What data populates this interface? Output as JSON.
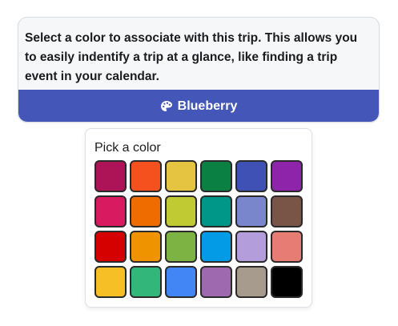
{
  "card": {
    "description": "Select a color to associate with this trip. This allows you to easily indentify a trip at a glance, like finding a trip event in your calendar.",
    "button_label": "Blueberry",
    "button_icon": "palette-icon",
    "button_color": "#4456b8"
  },
  "picker": {
    "title": "Pick a color",
    "swatches": [
      {
        "color": "#ad1457"
      },
      {
        "color": "#f4511e"
      },
      {
        "color": "#e4c441"
      },
      {
        "color": "#0b8043"
      },
      {
        "color": "#3f51b5"
      },
      {
        "color": "#8e24aa"
      },
      {
        "color": "#d81b60"
      },
      {
        "color": "#ef6c00"
      },
      {
        "color": "#c0ca33"
      },
      {
        "color": "#009688"
      },
      {
        "color": "#7986cb"
      },
      {
        "color": "#795548"
      },
      {
        "color": "#d50000"
      },
      {
        "color": "#f09300"
      },
      {
        "color": "#7cb342"
      },
      {
        "color": "#039be5"
      },
      {
        "color": "#b39ddb"
      },
      {
        "color": "#e67c73"
      },
      {
        "color": "#f6bf26"
      },
      {
        "color": "#33b679"
      },
      {
        "color": "#4285f4"
      },
      {
        "color": "#9e69af"
      },
      {
        "color": "#a79b8e"
      },
      {
        "color": "#000000"
      }
    ]
  }
}
